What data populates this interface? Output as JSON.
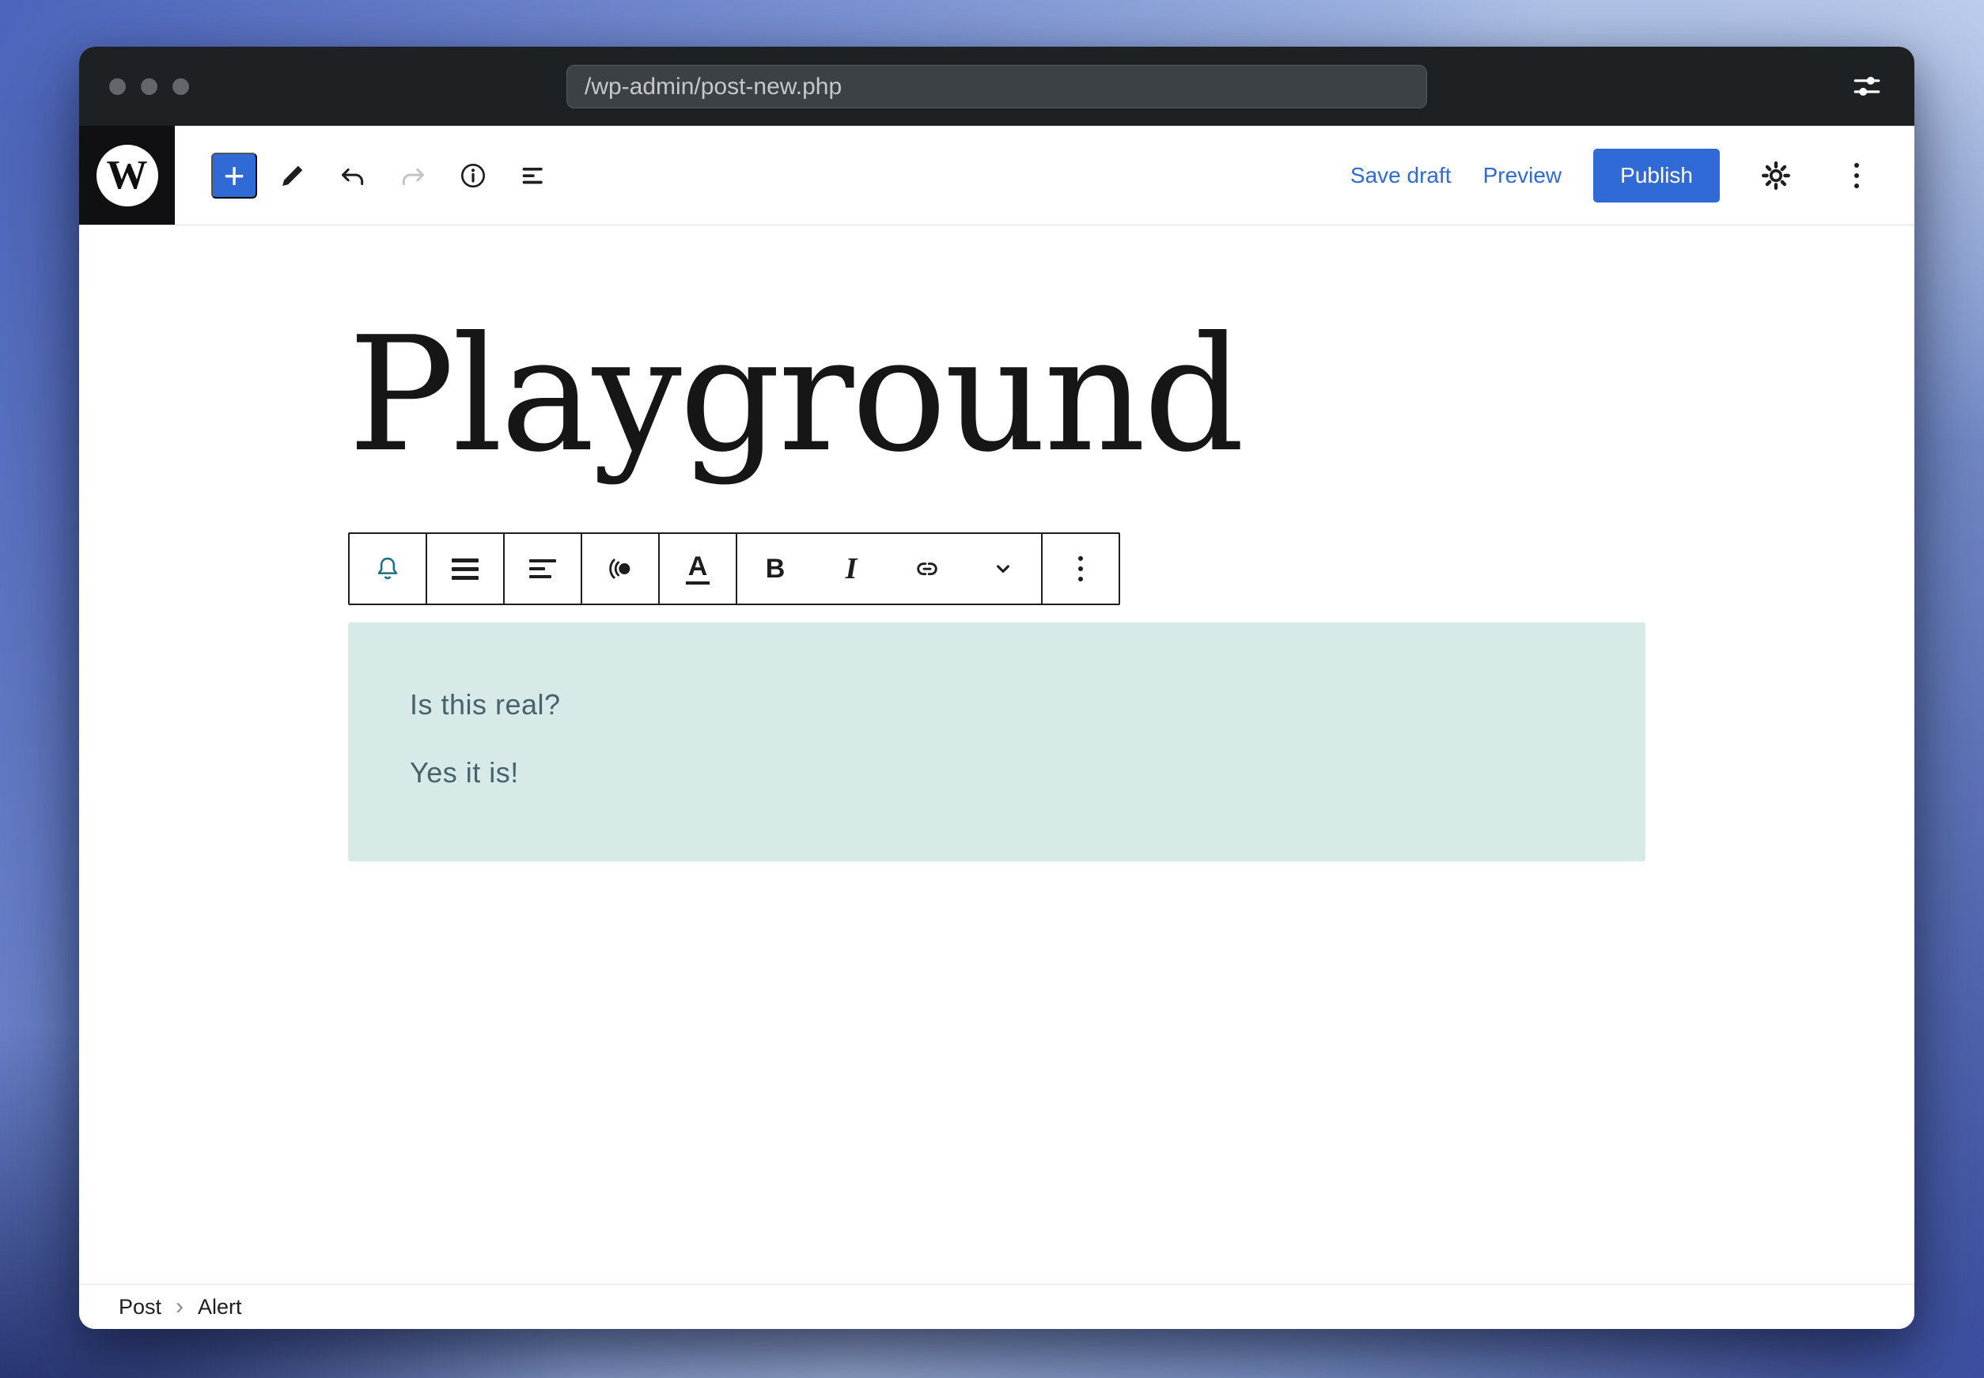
{
  "window": {
    "url": "/wp-admin/post-new.php"
  },
  "header": {
    "save_draft_label": "Save draft",
    "preview_label": "Preview",
    "publish_label": "Publish"
  },
  "content": {
    "post_title": "Playground",
    "alert": {
      "line1": "Is this real?",
      "line2": "Yes it is!"
    }
  },
  "breadcrumb": {
    "post": "Post",
    "separator": "›",
    "block": "Alert"
  },
  "icons": {
    "plus": "+",
    "bold": "B",
    "italic": "I",
    "text_color": "A"
  },
  "colors": {
    "accent_blue": "#2f6ad7",
    "titlebar_bg": "#1e2124",
    "alert_bg": "#d8eae8",
    "alert_text": "#48626c",
    "block_icon_teal": "#19717f"
  }
}
